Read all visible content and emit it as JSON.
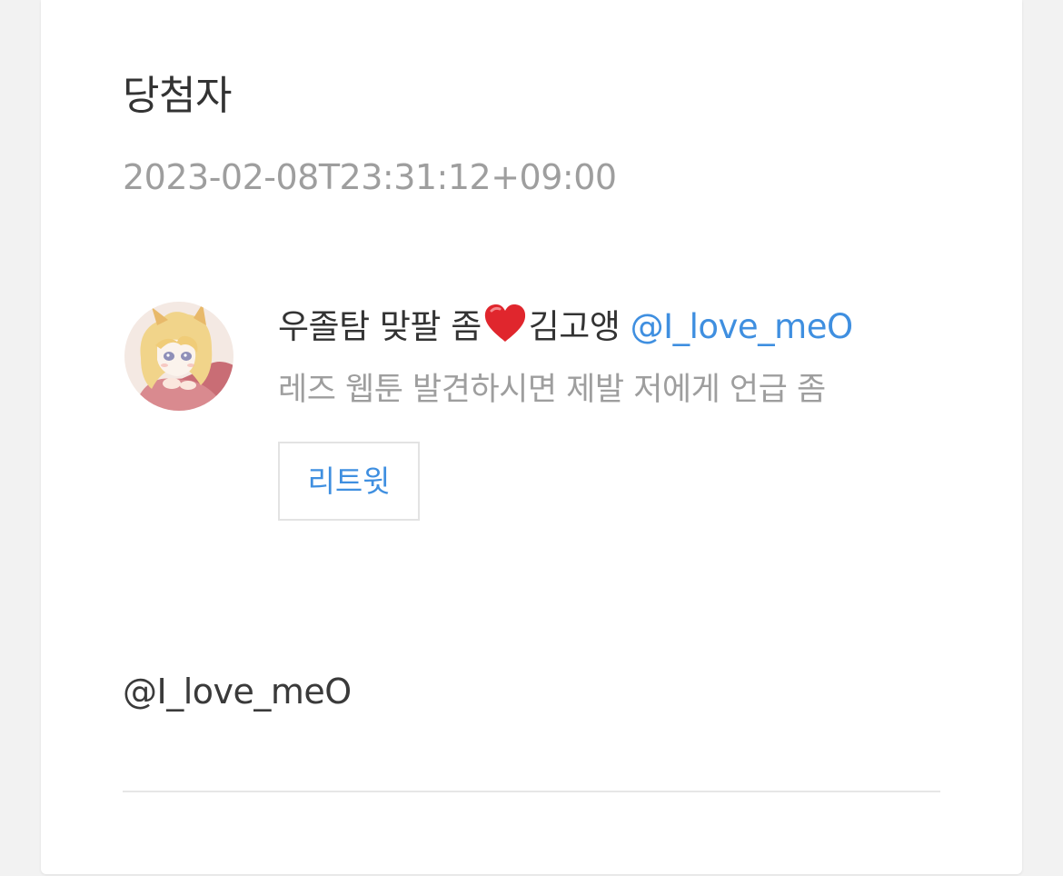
{
  "card": {
    "title": "당첨자",
    "timestamp": "2023-02-08T23:31:12+09:00"
  },
  "winner": {
    "name_part1": "우졸탐 맞팔 좀",
    "name_part2": "김고앵",
    "handle": "@I_love_meO",
    "bio": "레즈 웹툰 발견하시면 제발 저에게 언급 좀",
    "retweet_label": "리트윗",
    "name_emoji": "heart-icon"
  },
  "footer": {
    "mention": "@I_love_meO"
  },
  "colors": {
    "link": "#3f8fe0",
    "muted_text": "#9e9e9e",
    "primary_text": "#333333",
    "heart": "#e0262d"
  }
}
